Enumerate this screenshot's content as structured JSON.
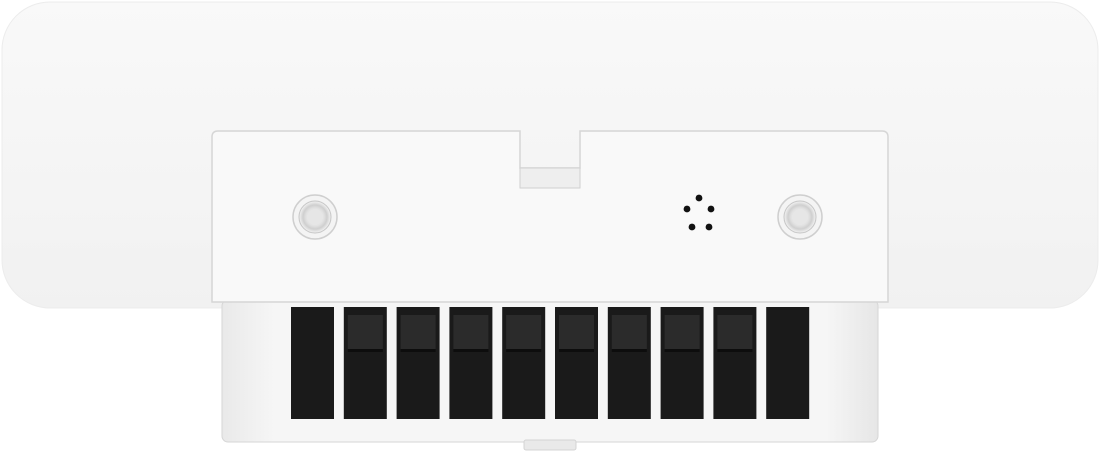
{
  "image": {
    "subject": "wall-mount-device-bottom-view",
    "colors": {
      "body": "#f6f6f6",
      "plate": "#f9f9f9",
      "lower_housing": "#f2f2f2",
      "vent_slot": "#1a1a1a",
      "vent_inner": "#2b2b2b",
      "mic_hole": "#111111",
      "screw": "#e4e4e4",
      "edge": "#d6d6d6"
    },
    "vent_slot_count": 10,
    "mic_hole_count": 5,
    "screw_count": 2
  }
}
